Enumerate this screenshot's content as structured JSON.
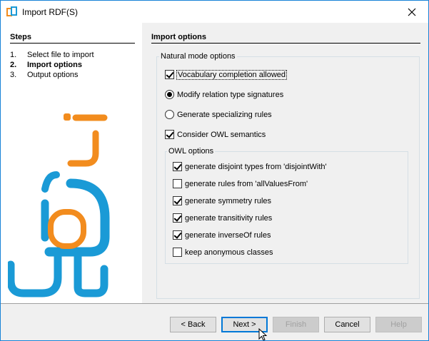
{
  "window": {
    "title": "Import RDF(S)",
    "icon": "app-icon",
    "close_icon": "close-icon"
  },
  "steps": {
    "heading": "Steps",
    "items": [
      {
        "num": "1.",
        "label": "Select file to import",
        "active": false
      },
      {
        "num": "2.",
        "label": "Import options",
        "active": true
      },
      {
        "num": "3.",
        "label": "Output options",
        "active": false
      }
    ]
  },
  "import_options": {
    "heading": "Import options",
    "natural_mode": {
      "title": "Natural mode options",
      "vocabulary_completion": {
        "label": "Vocabulary completion allowed",
        "checked": true
      },
      "modify_relation": {
        "label": "Modify relation type signatures",
        "selected": true
      },
      "generate_specializing": {
        "label": "Generate specializing rules",
        "selected": false
      },
      "consider_owl": {
        "label": "Consider OWL semantics",
        "checked": true
      }
    },
    "owl_options": {
      "title": "OWL options",
      "items": [
        {
          "label": "generate disjoint types from 'disjointWith'",
          "checked": true
        },
        {
          "label": "generate rules from 'allValuesFrom'",
          "checked": false
        },
        {
          "label": "generate symmetry rules",
          "checked": true
        },
        {
          "label": "generate transitivity rules",
          "checked": true
        },
        {
          "label": "generate inverseOf rules",
          "checked": true
        },
        {
          "label": "keep anonymous classes",
          "checked": false
        }
      ]
    }
  },
  "buttons": {
    "back": "< Back",
    "next": "Next >",
    "finish": "Finish",
    "cancel": "Cancel",
    "help": "Help"
  },
  "colors": {
    "logo_blue": "#1a9ad6",
    "logo_orange": "#f28c1e",
    "accent": "#0078d7"
  }
}
